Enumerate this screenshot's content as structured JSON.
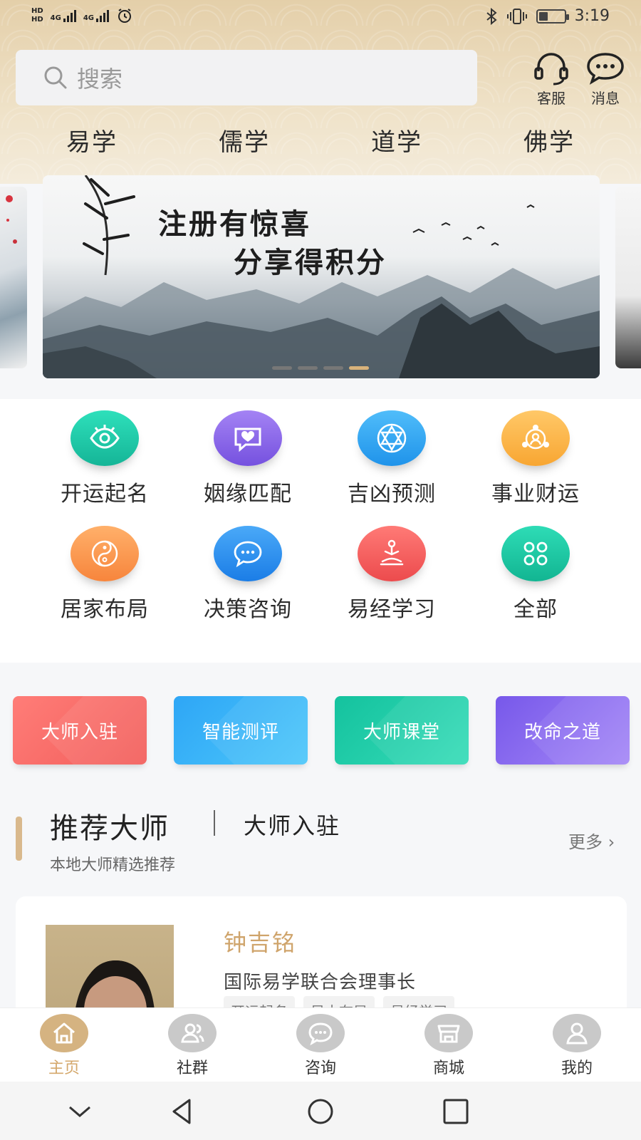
{
  "status_bar": {
    "network_left": "HD",
    "network_type_1": "4G",
    "network_type_2": "4G",
    "time": "3:19"
  },
  "header": {
    "search_placeholder": "搜索",
    "customer_service_label": "客服",
    "messages_label": "消息",
    "categories": [
      "易学",
      "儒学",
      "道学",
      "佛学"
    ]
  },
  "banner": {
    "line1": "注册有惊喜",
    "line2": "分享得积分",
    "slide_count": 4,
    "active_slide": 4
  },
  "functions": [
    {
      "label": "开运起名",
      "icon": "eye-icon",
      "color": "#1fc9a8"
    },
    {
      "label": "姻缘匹配",
      "icon": "heart-chat-icon",
      "color": "#8b63e8"
    },
    {
      "label": "吉凶预测",
      "icon": "hexagram-icon",
      "color": "#34a8f5"
    },
    {
      "label": "事业财运",
      "icon": "network-user-icon",
      "color": "#fbb24a"
    },
    {
      "label": "居家布局",
      "icon": "yin-yang-icon",
      "color": "#fb9a52"
    },
    {
      "label": "决策咨询",
      "icon": "chat-bubble-icon",
      "color": "#2c90f0"
    },
    {
      "label": "易经学习",
      "icon": "meditation-icon",
      "color": "#f46261"
    },
    {
      "label": "全部",
      "icon": "grid-four-icon",
      "color": "#1ec9a2"
    }
  ],
  "features": [
    {
      "label": "大师入驻",
      "color": "#fa6d6a"
    },
    {
      "label": "智能测评",
      "color": "#35b4f7"
    },
    {
      "label": "大师课堂",
      "color": "#1fcaa9"
    },
    {
      "label": "改命之道",
      "color": "#8a6cf0"
    }
  ],
  "section": {
    "title": "推荐大师",
    "subtitle": "大师入驻",
    "description": "本地大师精选推荐",
    "more": "更多 ›"
  },
  "master": {
    "name": "钟吉铭",
    "title": "国际易学联合会理事长",
    "tags": [
      "开运起名",
      "风水布局",
      "易经学习"
    ]
  },
  "tabbar": [
    {
      "label": "主页",
      "icon": "home-icon",
      "active": true
    },
    {
      "label": "社群",
      "icon": "group-icon",
      "active": false
    },
    {
      "label": "咨询",
      "icon": "chat-icon",
      "active": false
    },
    {
      "label": "商城",
      "icon": "shop-icon",
      "active": false
    },
    {
      "label": "我的",
      "icon": "user-icon",
      "active": false
    }
  ],
  "colors": {
    "accent": "#d5b381",
    "header_bg": "#e9d8b8"
  }
}
